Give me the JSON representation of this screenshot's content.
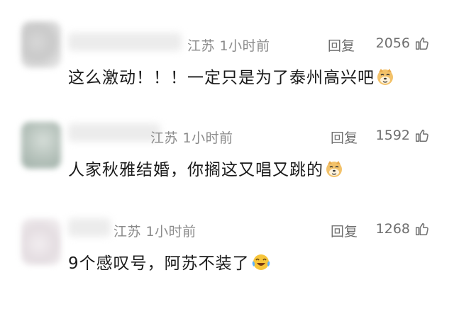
{
  "comments": [
    {
      "location_time": "江苏 1小时前",
      "reply_label": "回复",
      "likes": "2056",
      "text": "这么激动！！！一定只是为了泰州高兴吧",
      "emoji": "doge-icon"
    },
    {
      "location_time": "江苏 1小时前",
      "reply_label": "回复",
      "likes": "1592",
      "text": "人家秋雅结婚，你搁这又唱又跳的",
      "emoji": "doge-icon"
    },
    {
      "location_time": "江苏 1小时前",
      "reply_label": "回复",
      "likes": "1268",
      "text": "9个感叹号，阿苏不装了",
      "emoji": "laugh-cry-icon"
    }
  ],
  "colors": {
    "meta": "#8a8a8a",
    "text": "#1a1a1a",
    "doge": "#f3c26a"
  }
}
